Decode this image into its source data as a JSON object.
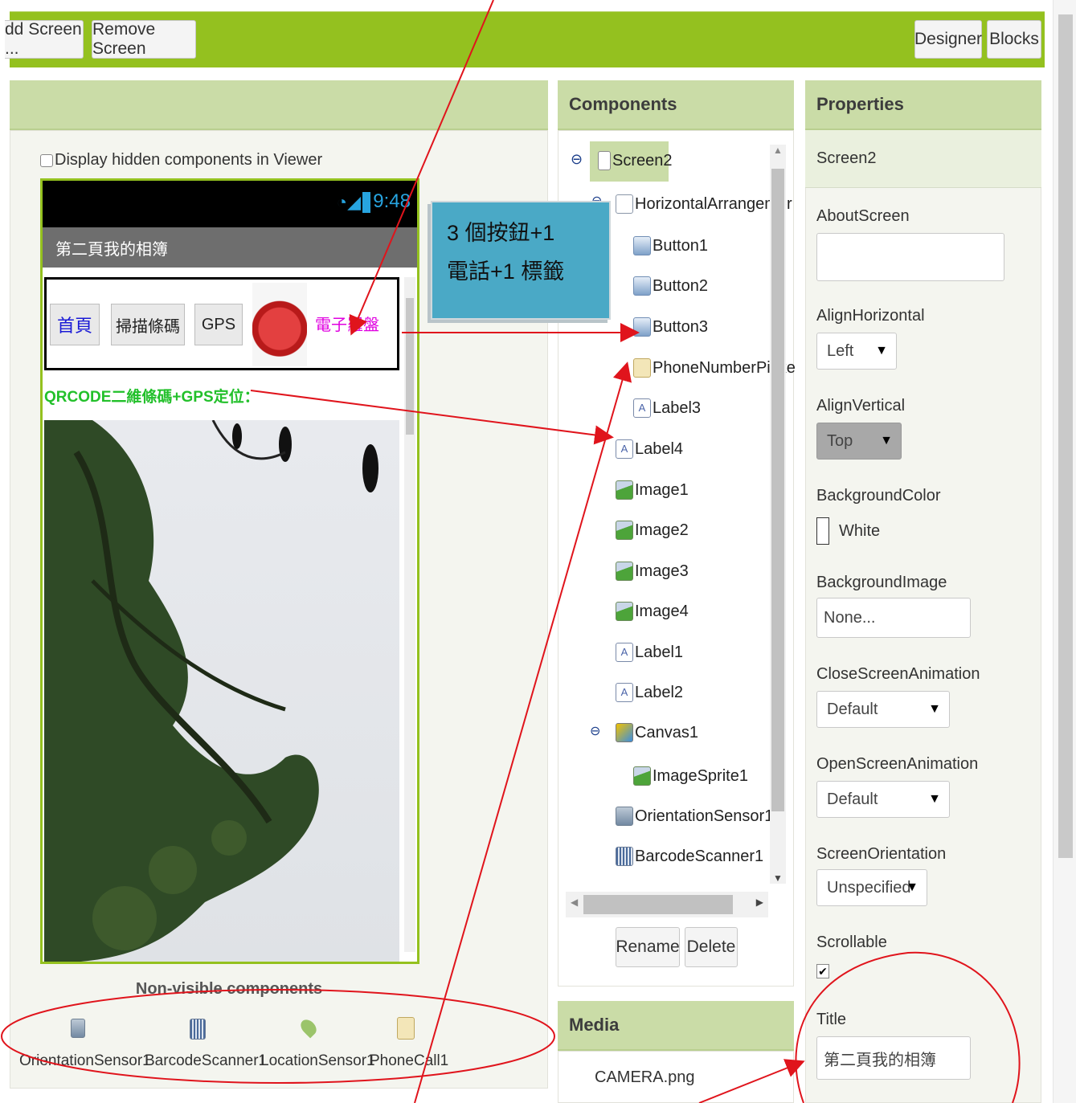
{
  "toolbar": {
    "add_screen": "dd Screen ...",
    "remove_screen": "Remove Screen",
    "designer": "Designer",
    "blocks": "Blocks"
  },
  "viewer": {
    "hidden_checkbox_label": "Display hidden components in Viewer",
    "status_time": "9:48",
    "app_title": "第二頁我的相簿",
    "buttons": [
      "首頁",
      "掃描條碼",
      "GPS"
    ],
    "phone_label": "電子羅盤",
    "qr_label": "QRCODE二維條碼+GPS定位：",
    "nonvisible_heading": "Non-visible components",
    "nonvisible": [
      "OrientationSensor1",
      "BarcodeScanner1",
      "LocationSensor1",
      "PhoneCall1"
    ]
  },
  "annotation": {
    "line1": "3 個按鈕+1",
    "line2": "電話+1 標籤"
  },
  "components": {
    "heading": "Components",
    "tree": [
      {
        "label": "Screen2",
        "icon": "screen-icon"
      },
      {
        "label": "HorizontalArrangemer",
        "icon": "horizontal-arrangement-icon"
      },
      {
        "label": "Button1",
        "icon": "button-icon"
      },
      {
        "label": "Button2",
        "icon": "button-icon"
      },
      {
        "label": "Button3",
        "icon": "button-icon"
      },
      {
        "label": "PhoneNumberPicke",
        "icon": "phone-number-picker-icon"
      },
      {
        "label": "Label3",
        "icon": "label-icon"
      },
      {
        "label": "Label4",
        "icon": "label-icon"
      },
      {
        "label": "Image1",
        "icon": "image-icon"
      },
      {
        "label": "Image2",
        "icon": "image-icon"
      },
      {
        "label": "Image3",
        "icon": "image-icon"
      },
      {
        "label": "Image4",
        "icon": "image-icon"
      },
      {
        "label": "Label1",
        "icon": "label-icon"
      },
      {
        "label": "Label2",
        "icon": "label-icon"
      },
      {
        "label": "Canvas1",
        "icon": "canvas-icon"
      },
      {
        "label": "ImageSprite1",
        "icon": "image-sprite-icon"
      },
      {
        "label": "OrientationSensor1",
        "icon": "orientation-sensor-icon"
      },
      {
        "label": "BarcodeScanner1",
        "icon": "barcode-scanner-icon"
      }
    ],
    "rename": "Rename",
    "delete": "Delete"
  },
  "media": {
    "heading": "Media",
    "files": [
      "CAMERA.png"
    ]
  },
  "properties": {
    "heading": "Properties",
    "component": "Screen2",
    "about_screen": {
      "label": "AboutScreen",
      "value": ""
    },
    "align_horizontal": {
      "label": "AlignHorizontal",
      "value": "Left"
    },
    "align_vertical": {
      "label": "AlignVertical",
      "value": "Top"
    },
    "background_color": {
      "label": "BackgroundColor",
      "value": "White"
    },
    "background_image": {
      "label": "BackgroundImage",
      "value": "None..."
    },
    "close_anim": {
      "label": "CloseScreenAnimation",
      "value": "Default"
    },
    "open_anim": {
      "label": "OpenScreenAnimation",
      "value": "Default"
    },
    "orientation": {
      "label": "ScreenOrientation",
      "value": "Unspecified"
    },
    "scrollable": {
      "label": "Scrollable",
      "checked": true
    },
    "title": {
      "label": "Title",
      "value": "第二頁我的相簿"
    }
  },
  "colors": {
    "toolbar_green": "#94c11f",
    "panel_header": "#cadca7",
    "annotation_box": "#4aa9c6",
    "arrow_red": "#e0141c",
    "qr_label_green": "#22c02a",
    "phone_label_magenta": "#e000e0",
    "button_text_blue": "#1a1ad6"
  }
}
